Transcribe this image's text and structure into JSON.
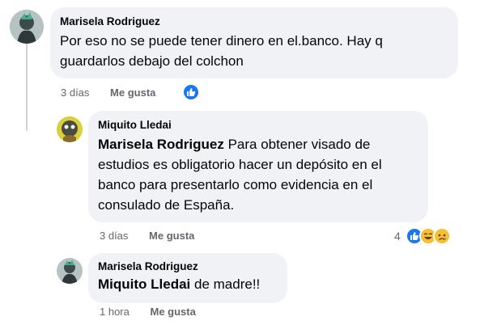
{
  "comments": [
    {
      "author": "Marisela Rodriguez",
      "text": "Por eso no se puede tener dinero en el.banco. Hay q guardarlos debajo del colchon",
      "time": "3 días",
      "like_label": "Me gusta"
    },
    {
      "author": "Miquito Lledai",
      "mention": "Marisela Rodriguez",
      "text": " Para obtener visado de estudios es obligatorio hacer un depósito en el banco para presentarlo como evidencia en el consulado de España.",
      "time": "3 días",
      "like_label": "Me gusta",
      "reaction_count": "4"
    },
    {
      "author": "Marisela Rodriguez",
      "mention": "Miquito Lledai",
      "text": " de madre!!",
      "time": "1 hora",
      "like_label": "Me gusta"
    }
  ],
  "colors": {
    "bubble": "#f0f2f5",
    "like_blue": "#1877f2",
    "meta_gray": "#65676b"
  },
  "icons": {
    "like": "thumbs-up-icon",
    "laugh": "laugh-emoji-icon",
    "sad": "sad-emoji-icon"
  }
}
